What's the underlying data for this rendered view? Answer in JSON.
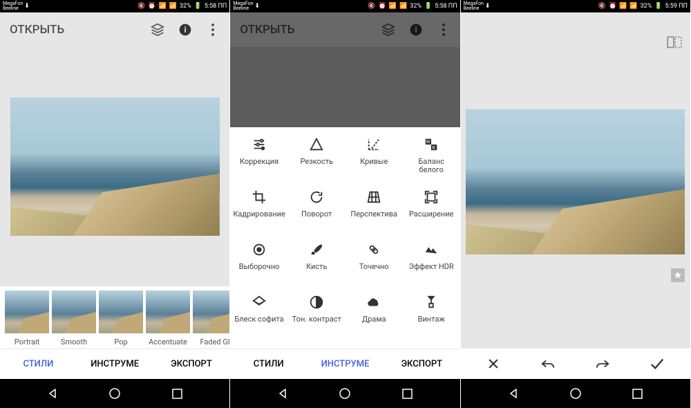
{
  "status": {
    "carrier1": "MegaFon",
    "carrier2": "Beeline",
    "battery": "32%",
    "time1": "5:58 ПП",
    "time2": "5:58 ПП",
    "time3": "5:59 ПП"
  },
  "topbar": {
    "open_label": "ОТКРЫТЬ"
  },
  "styles": [
    {
      "label": "Portrait"
    },
    {
      "label": "Smooth"
    },
    {
      "label": "Pop"
    },
    {
      "label": "Accentuate"
    },
    {
      "label": "Faded Gl"
    }
  ],
  "tabs": {
    "styles": "СТИЛИ",
    "tools": "ИНСТРУМЕ",
    "export": "ЭКСПОРТ"
  },
  "tools": [
    {
      "icon": "tune",
      "label": "Коррекция"
    },
    {
      "icon": "details",
      "label": "Резкость"
    },
    {
      "icon": "curves",
      "label": "Кривые"
    },
    {
      "icon": "wb",
      "label": "Баланс белого"
    },
    {
      "icon": "crop",
      "label": "Кадрирование"
    },
    {
      "icon": "rotate",
      "label": "Поворот"
    },
    {
      "icon": "perspective",
      "label": "Перспектива"
    },
    {
      "icon": "expand",
      "label": "Расширение"
    },
    {
      "icon": "selective",
      "label": "Выборочно"
    },
    {
      "icon": "brush",
      "label": "Кисть"
    },
    {
      "icon": "healing",
      "label": "Точечно"
    },
    {
      "icon": "hdr",
      "label": "Эффект HDR"
    },
    {
      "icon": "glamour",
      "label": "Блеск софита"
    },
    {
      "icon": "tonal",
      "label": "Тон. контраст"
    },
    {
      "icon": "drama",
      "label": "Драма"
    },
    {
      "icon": "vintage",
      "label": "Винтаж"
    }
  ]
}
